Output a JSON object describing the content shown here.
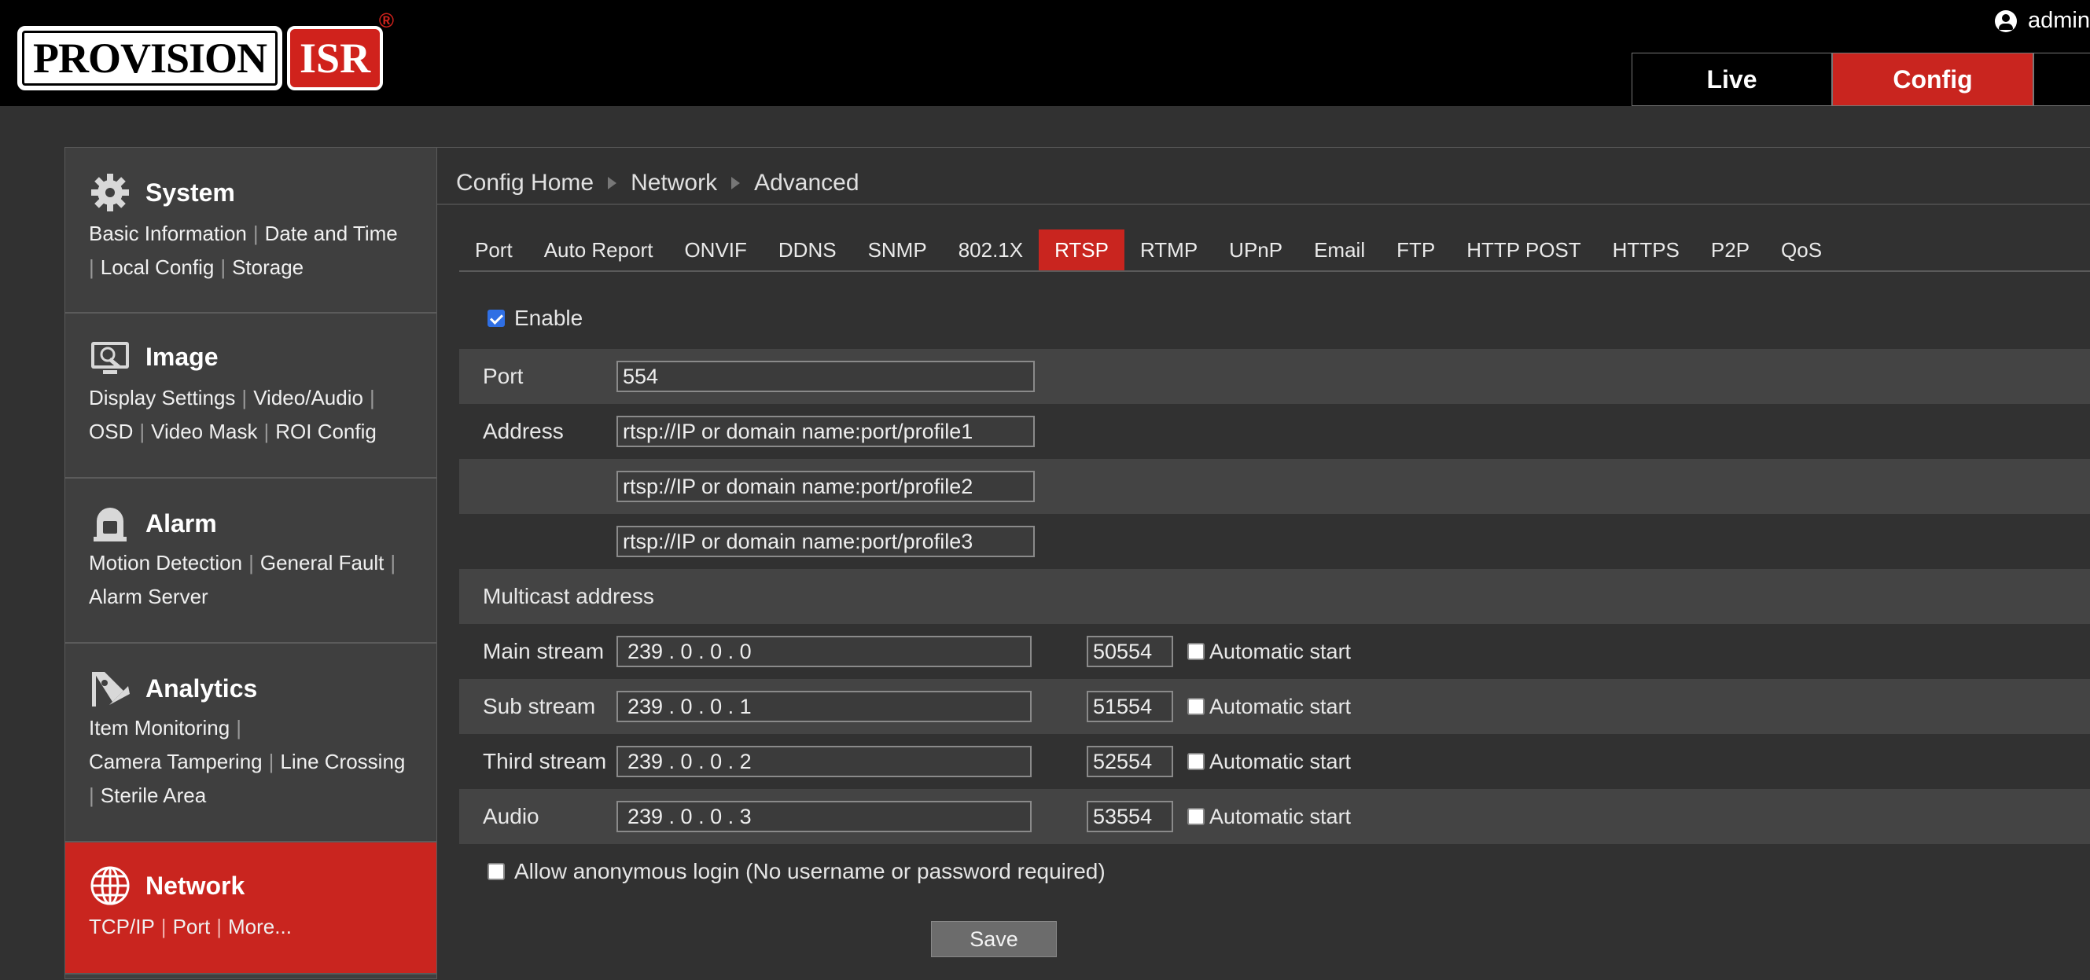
{
  "brand": {
    "logo_main": "PROVISION",
    "logo_isr": "ISR",
    "registered": "®"
  },
  "user": {
    "name": "admin"
  },
  "topnav": {
    "live": "Live",
    "config": "Config"
  },
  "sidebar": {
    "system": {
      "title": "System",
      "links": [
        "Basic Information",
        "Date and Time",
        "Local Config",
        "Storage"
      ]
    },
    "image": {
      "title": "Image",
      "links": [
        "Display Settings",
        "Video/Audio",
        "OSD",
        "Video Mask",
        "ROI Config"
      ]
    },
    "alarm": {
      "title": "Alarm",
      "links": [
        "Motion Detection",
        "General Fault",
        "Alarm Server"
      ]
    },
    "analytics": {
      "title": "Analytics",
      "links": [
        "Item Monitoring",
        "Camera Tampering",
        "Line Crossing",
        "Sterile Area"
      ]
    },
    "network": {
      "title": "Network",
      "links": [
        "TCP/IP",
        "Port",
        "More..."
      ]
    }
  },
  "breadcrumb": [
    "Config Home",
    "Network",
    "Advanced"
  ],
  "tabs": [
    "Port",
    "Auto Report",
    "ONVIF",
    "DDNS",
    "SNMP",
    "802.1X",
    "RTSP",
    "RTMP",
    "UPnP",
    "Email",
    "FTP",
    "HTTP POST",
    "HTTPS",
    "P2P",
    "QoS"
  ],
  "active_tab": "RTSP",
  "form": {
    "enable_label": "Enable",
    "enable_checked": true,
    "port_label": "Port",
    "port_value": "554",
    "address_label": "Address",
    "address_1": "rtsp://IP or domain name:port/profile1",
    "address_2": "rtsp://IP or domain name:port/profile2",
    "address_3": "rtsp://IP or domain name:port/profile3",
    "multicast_label": "Multicast address",
    "streams": [
      {
        "label": "Main stream",
        "ip": "239 . 0 . 0 . 0",
        "port": "50554",
        "auto_label": "Automatic start",
        "auto_checked": false
      },
      {
        "label": "Sub stream",
        "ip": "239 . 0 . 0 . 1",
        "port": "51554",
        "auto_label": "Automatic start",
        "auto_checked": false
      },
      {
        "label": "Third stream",
        "ip": "239 . 0 . 0 . 2",
        "port": "52554",
        "auto_label": "Automatic start",
        "auto_checked": false
      },
      {
        "label": "Audio",
        "ip": "239 . 0 . 0 . 3",
        "port": "53554",
        "auto_label": "Automatic start",
        "auto_checked": false
      }
    ],
    "anonymous_label": "Allow anonymous login (No username or password required)",
    "anonymous_checked": false,
    "save_label": "Save"
  },
  "colors": {
    "accent": "#c9251f",
    "topbar": "#000000",
    "panel": "#3f3f3f",
    "background": "#313131"
  }
}
